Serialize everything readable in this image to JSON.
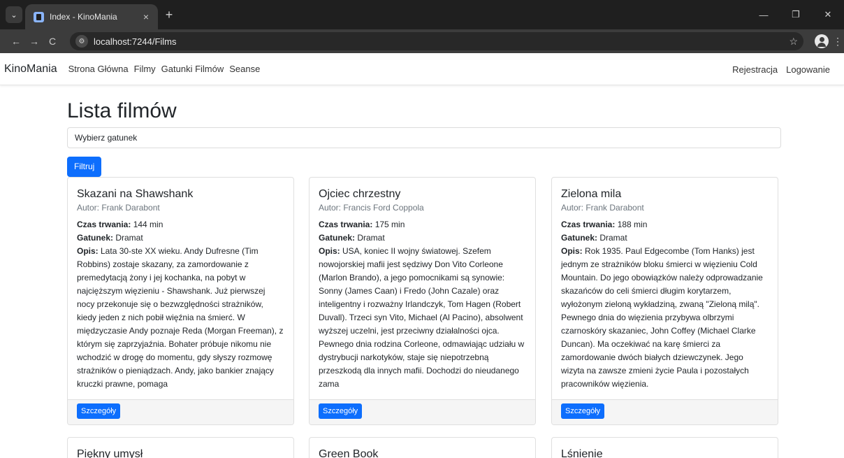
{
  "browser": {
    "tab_title": "Index - KinoMania",
    "tab_close": "×",
    "new_tab": "+",
    "url": "localhost:7244/Films",
    "back": "←",
    "forward": "→",
    "reload": "C",
    "minimize": "—",
    "restore": "❐",
    "close": "✕",
    "star": "☆",
    "menu": "⋮",
    "tab_list": "⌄"
  },
  "navbar": {
    "brand": "KinoMania",
    "links": [
      "Strona Główna",
      "Filmy",
      "Gatunki Filmów",
      "Seanse"
    ],
    "right_links": [
      "Rejestracja",
      "Logowanie"
    ]
  },
  "page": {
    "title": "Lista filmów",
    "genre_select": "Wybierz gatunek",
    "filter_button": "Filtruj"
  },
  "labels": {
    "duration": "Czas trwania:",
    "genre": "Gatunek:",
    "description": "Opis:",
    "details": "Szczegóły"
  },
  "films": [
    {
      "title": "Skazani na Shawshank",
      "author": "Autor: Frank Darabont",
      "duration": " 144 min",
      "genre": " Dramat",
      "description": " Lata 30-ste XX wieku. Andy Dufresne (Tim Robbins) zostaje skazany, za zamordowanie z premedytacją żony i jej kochanka, na pobyt w najcięższym więzieniu - Shawshank. Już pierwszej nocy przekonuje się o bezwzględności strażników, kiedy jeden z nich pobił więźnia na śmierć. W międzyczasie Andy poznaje Reda (Morgan Freeman), z którym się zaprzyjaźnia. Bohater próbuje nikomu nie wchodzić w drogę do momentu, gdy słyszy rozmowę strażników o pieniądzach. Andy, jako bankier znający kruczki prawne, pomaga"
    },
    {
      "title": "Ojciec chrzestny",
      "author": "Autor: Francis Ford Coppola",
      "duration": " 175 min",
      "genre": " Dramat",
      "description": " USA, koniec II wojny światowej. Szefem nowojorskiej mafii jest sędziwy Don Vito Corleone (Marlon Brando), a jego pomocnikami są synowie: Sonny (James Caan) i Fredo (John Cazale) oraz inteligentny i rozważny Irlandczyk, Tom Hagen (Robert Duvall). Trzeci syn Vito, Michael (Al Pacino), absolwent wyższej uczelni, jest przeciwny działalności ojca. Pewnego dnia rodzina Corleone, odmawiając udziału w dystrybucji narkotyków, staje się niepotrzebną przeszkodą dla innych mafii. Dochodzi do nieudanego zama"
    },
    {
      "title": "Zielona mila",
      "author": "Autor: Frank Darabont",
      "duration": " 188 min",
      "genre": " Dramat",
      "description": " Rok 1935. Paul Edgecombe (Tom Hanks) jest jednym ze strażników bloku śmierci w więzieniu Cold Mountain. Do jego obowiązków należy odprowadzanie skazańców do celi śmierci długim korytarzem, wyłożonym zieloną wykładziną, zwaną \"Zieloną milą\". Pewnego dnia do więzienia przybywa olbrzymi czarnoskóry skazaniec, John Coffey (Michael Clarke Duncan). Ma oczekiwać na karę śmierci za zamordowanie dwóch białych dziewczynek. Jego wizyta na zawsze zmieni życie Paula i pozostałych pracowników więzienia."
    }
  ],
  "films_partial": [
    "Piękny umysł",
    "Green Book",
    "Lśnienie"
  ]
}
